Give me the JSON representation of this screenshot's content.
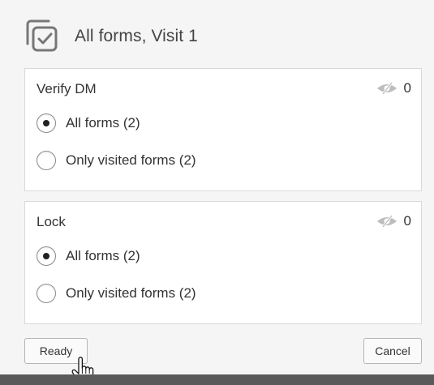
{
  "header": {
    "title": "All forms, Visit 1",
    "icon": "checkbox-stack-icon"
  },
  "sections": [
    {
      "title": "Verify DM",
      "hidden_count": "0",
      "options": [
        {
          "label": "All forms (2)",
          "selected": true
        },
        {
          "label": "Only visited forms (2)",
          "selected": false
        }
      ]
    },
    {
      "title": "Lock",
      "hidden_count": "0",
      "options": [
        {
          "label": "All forms (2)",
          "selected": true
        },
        {
          "label": "Only visited forms (2)",
          "selected": false
        }
      ]
    }
  ],
  "footer": {
    "ready_label": "Ready",
    "cancel_label": "Cancel"
  },
  "colors": {
    "panel_background": "#f5f5f5",
    "card_background": "#ffffff",
    "icon_gray": "#777777"
  }
}
